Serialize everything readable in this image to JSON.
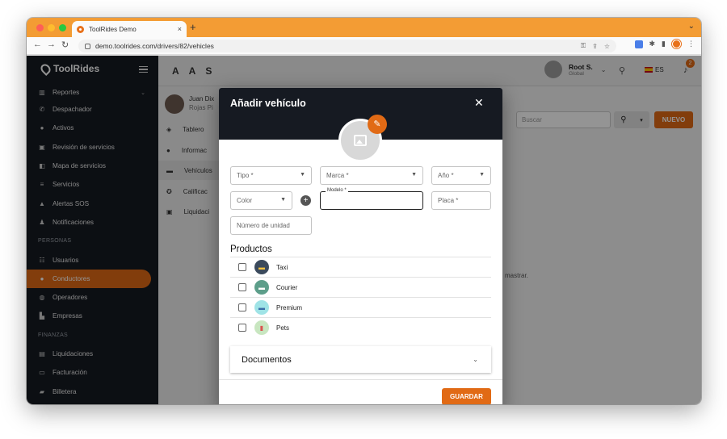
{
  "browser": {
    "tab_title": "ToolRides Demo",
    "tab_close": "×",
    "new_tab": "+",
    "url": "demo.toolrides.com/drivers/82/vehicles",
    "accent": "#f39c34"
  },
  "sidebar": {
    "brand": "ToolRides",
    "items": [
      {
        "icon": "chart-icon",
        "label": "Reportes",
        "has_chevron": true
      },
      {
        "icon": "phone-icon",
        "label": "Despachador"
      },
      {
        "icon": "circle-icon",
        "label": "Activos"
      },
      {
        "icon": "review-icon",
        "label": "Revisión de servicios"
      },
      {
        "icon": "map-icon",
        "label": "Mapa de servicios"
      },
      {
        "icon": "list-icon",
        "label": "Servicios"
      },
      {
        "icon": "warning-icon",
        "label": "Alertas SOS"
      },
      {
        "icon": "bell-icon",
        "label": "Notificaciones"
      }
    ],
    "section_personas": "PERSONAS",
    "personas_items": [
      {
        "icon": "users-icon",
        "label": "Usuarios"
      },
      {
        "icon": "driver-icon",
        "label": "Conductores",
        "active": true
      },
      {
        "icon": "globe-icon",
        "label": "Operadores"
      },
      {
        "icon": "building-icon",
        "label": "Empresas"
      }
    ],
    "section_finanzas": "FINANZAS",
    "finanzas_items": [
      {
        "icon": "receipt-icon",
        "label": "Liquidaciones"
      },
      {
        "icon": "card-icon",
        "label": "Facturación"
      },
      {
        "icon": "wallet-icon",
        "label": "Billetera"
      }
    ]
  },
  "topbar": {
    "letters": [
      "A",
      "A",
      "S"
    ],
    "user_name": "Root S.",
    "user_role": "Global",
    "language": "ES",
    "notification_count": "2"
  },
  "driver_panel": {
    "name_line1": "Juan Dix",
    "name_line2": "Rojas Pi",
    "items": [
      "Tablero",
      "Informac",
      "Vehículos",
      "Calificac",
      "Liquidaci"
    ]
  },
  "list": {
    "search_placeholder": "Buscar",
    "new_button": "NUEVO",
    "empty_message": "mastrar."
  },
  "dialog": {
    "title": "Añadir vehículo",
    "close": "✕",
    "fields": {
      "tipo": "Tipo *",
      "marca": "Marca *",
      "anio": "Año *",
      "color": "Color",
      "modelo_label": "Modelo *",
      "modelo_value": "",
      "placa": "Placa *",
      "unidad": "Número de unidad"
    },
    "productos_title": "Productos",
    "productos": [
      {
        "name": "Taxi",
        "color": "#3b4a5c",
        "icon_color": "#f0c040"
      },
      {
        "name": "Courier",
        "color": "#5d9e8a",
        "icon_color": "#ffffff"
      },
      {
        "name": "Premium",
        "color": "#9fe3e6",
        "icon_color": "#3a6ea8"
      },
      {
        "name": "Pets",
        "color": "#c8e6c0",
        "icon_color": "#d9534f"
      }
    ],
    "documentos": "Documentos",
    "save_button": "GUARDAR"
  },
  "colors": {
    "primary": "#e16a15",
    "sidebar_bg": "#161a22"
  }
}
